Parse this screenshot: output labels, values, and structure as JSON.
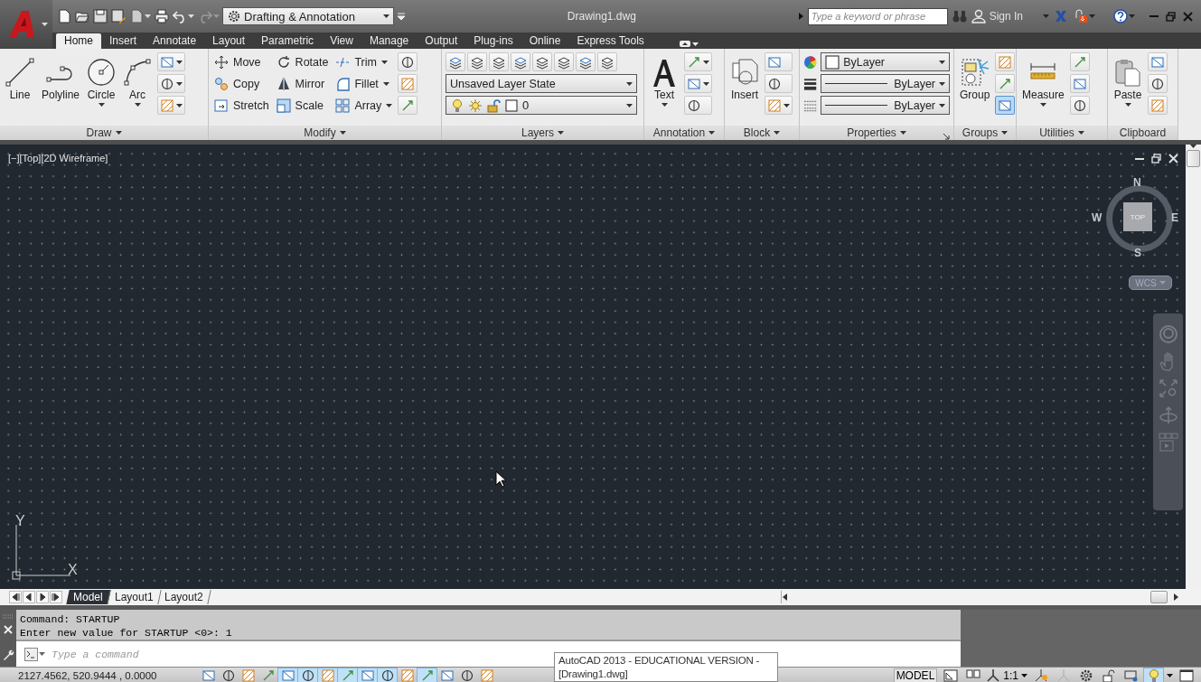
{
  "workspace": {
    "value": "Drafting & Annotation"
  },
  "title": "Drawing1.dwg",
  "search": {
    "placeholder": "Type a keyword or phrase"
  },
  "sign_in": "Sign In",
  "tabs": [
    {
      "label": "Home",
      "selected": true
    },
    {
      "label": "Insert",
      "selected": false
    },
    {
      "label": "Annotate",
      "selected": false
    },
    {
      "label": "Layout",
      "selected": false
    },
    {
      "label": "Parametric",
      "selected": false
    },
    {
      "label": "View",
      "selected": false
    },
    {
      "label": "Manage",
      "selected": false
    },
    {
      "label": "Output",
      "selected": false
    },
    {
      "label": "Plug-ins",
      "selected": false
    },
    {
      "label": "Online",
      "selected": false
    },
    {
      "label": "Express Tools",
      "selected": false
    }
  ],
  "panels": [
    {
      "label": "Draw",
      "menu": true,
      "launcher": false,
      "items": [
        {
          "kind": "large",
          "label": "Line",
          "menu": false
        },
        {
          "kind": "large",
          "label": "Polyline",
          "menu": false
        },
        {
          "kind": "large",
          "label": "Circle",
          "menu": true
        },
        {
          "kind": "large",
          "label": "Arc",
          "menu": true
        },
        {
          "kind": "icons",
          "buttons": [
            {
              "menu": true,
              "selected": false
            },
            {
              "menu": true,
              "selected": false
            },
            {
              "menu": true,
              "selected": false
            }
          ]
        }
      ]
    },
    {
      "label": "Modify",
      "menu": true,
      "launcher": false,
      "items": [
        {
          "kind": "labels",
          "buttons": [
            {
              "label": "Move",
              "menu": false
            },
            {
              "label": "Copy",
              "menu": false
            },
            {
              "label": "Stretch",
              "menu": false
            }
          ]
        },
        {
          "kind": "labels",
          "buttons": [
            {
              "label": "Rotate",
              "menu": false
            },
            {
              "label": "Mirror",
              "menu": false
            },
            {
              "label": "Scale",
              "menu": false
            }
          ]
        },
        {
          "kind": "labels",
          "buttons": [
            {
              "label": "Trim",
              "menu": true
            },
            {
              "label": "Fillet",
              "menu": true
            },
            {
              "label": "Array",
              "menu": true
            }
          ]
        },
        {
          "kind": "icons",
          "buttons": [
            {
              "menu": false,
              "selected": false
            },
            {
              "menu": false,
              "selected": false
            },
            {
              "menu": false,
              "selected": false
            }
          ]
        }
      ]
    },
    {
      "label": "Layers",
      "menu": true,
      "launcher": false,
      "items": [
        {
          "kind": "layers",
          "state": "Unsaved Layer State",
          "layer": "0"
        }
      ]
    },
    {
      "label": "Annotation",
      "menu": true,
      "launcher": false,
      "items": [
        {
          "kind": "large",
          "label": "Text",
          "menu": true
        },
        {
          "kind": "icons",
          "buttons": [
            {
              "menu": true,
              "selected": false
            },
            {
              "menu": true,
              "selected": false
            },
            {
              "menu": false,
              "selected": false
            }
          ]
        }
      ]
    },
    {
      "label": "Block",
      "menu": true,
      "launcher": false,
      "items": [
        {
          "kind": "large",
          "label": "Insert",
          "menu": false
        },
        {
          "kind": "icons",
          "buttons": [
            {
              "menu": false,
              "selected": false
            },
            {
              "menu": false,
              "selected": false
            },
            {
              "menu": true,
              "selected": false
            }
          ]
        }
      ]
    },
    {
      "label": "Properties",
      "menu": true,
      "launcher": true,
      "items": [
        {
          "kind": "properties",
          "rows": [
            {
              "kind": "color",
              "value": "ByLayer"
            },
            {
              "kind": "lineweight",
              "value": "ByLayer"
            },
            {
              "kind": "linetype",
              "value": "ByLayer"
            }
          ]
        }
      ]
    },
    {
      "label": "Groups",
      "menu": true,
      "launcher": false,
      "items": [
        {
          "kind": "large",
          "label": "Group",
          "menu": false
        },
        {
          "kind": "icons",
          "buttons": [
            {
              "menu": false,
              "selected": false
            },
            {
              "menu": false,
              "selected": false
            },
            {
              "menu": false,
              "selected": true
            }
          ]
        }
      ]
    },
    {
      "label": "Utilities",
      "menu": true,
      "launcher": false,
      "items": [
        {
          "kind": "large",
          "label": "Measure",
          "menu": true
        },
        {
          "kind": "icons",
          "buttons": [
            {
              "menu": false,
              "selected": false
            },
            {
              "menu": false,
              "selected": false
            },
            {
              "menu": false,
              "selected": false
            }
          ]
        }
      ]
    },
    {
      "label": "Clipboard",
      "menu": false,
      "launcher": false,
      "items": [
        {
          "kind": "large",
          "label": "Paste",
          "menu": true
        },
        {
          "kind": "icons",
          "buttons": [
            {
              "menu": false,
              "selected": false
            },
            {
              "menu": false,
              "selected": false
            },
            {
              "menu": false,
              "selected": false
            }
          ]
        }
      ]
    }
  ],
  "viewport": {
    "label": "[−][Top][2D Wireframe]",
    "viewcube": {
      "top": "TOP",
      "north": "N",
      "south": "S",
      "east": "E",
      "west": "W"
    },
    "ucs_menu": "WCS",
    "ucs_icon": {
      "x": "X",
      "y": "Y"
    }
  },
  "layout_tabs": [
    {
      "label": "Model",
      "selected": true
    },
    {
      "label": "Layout1",
      "selected": false
    },
    {
      "label": "Layout2",
      "selected": false
    }
  ],
  "command": {
    "history": [
      "Command: STARTUP",
      "Enter new value for STARTUP <0>: 1"
    ],
    "placeholder": "Type a command"
  },
  "status": {
    "coordinates": "2127.4562, 520.9444 , 0.0000",
    "toggles": [
      {
        "on": false
      },
      {
        "on": false
      },
      {
        "on": false
      },
      {
        "on": false
      },
      {
        "on": true
      },
      {
        "on": true
      },
      {
        "on": true
      },
      {
        "on": true
      },
      {
        "on": true
      },
      {
        "on": true
      },
      {
        "on": false
      },
      {
        "on": true
      },
      {
        "on": false
      },
      {
        "on": false
      },
      {
        "on": false
      }
    ],
    "space": "MODEL",
    "scale": "1:1",
    "isolate": {
      "on": true
    }
  },
  "tooltip": {
    "lines": [
      "AutoCAD 2013 - EDUCATIONAL VERSION -",
      "[Drawing1.dwg]"
    ]
  }
}
